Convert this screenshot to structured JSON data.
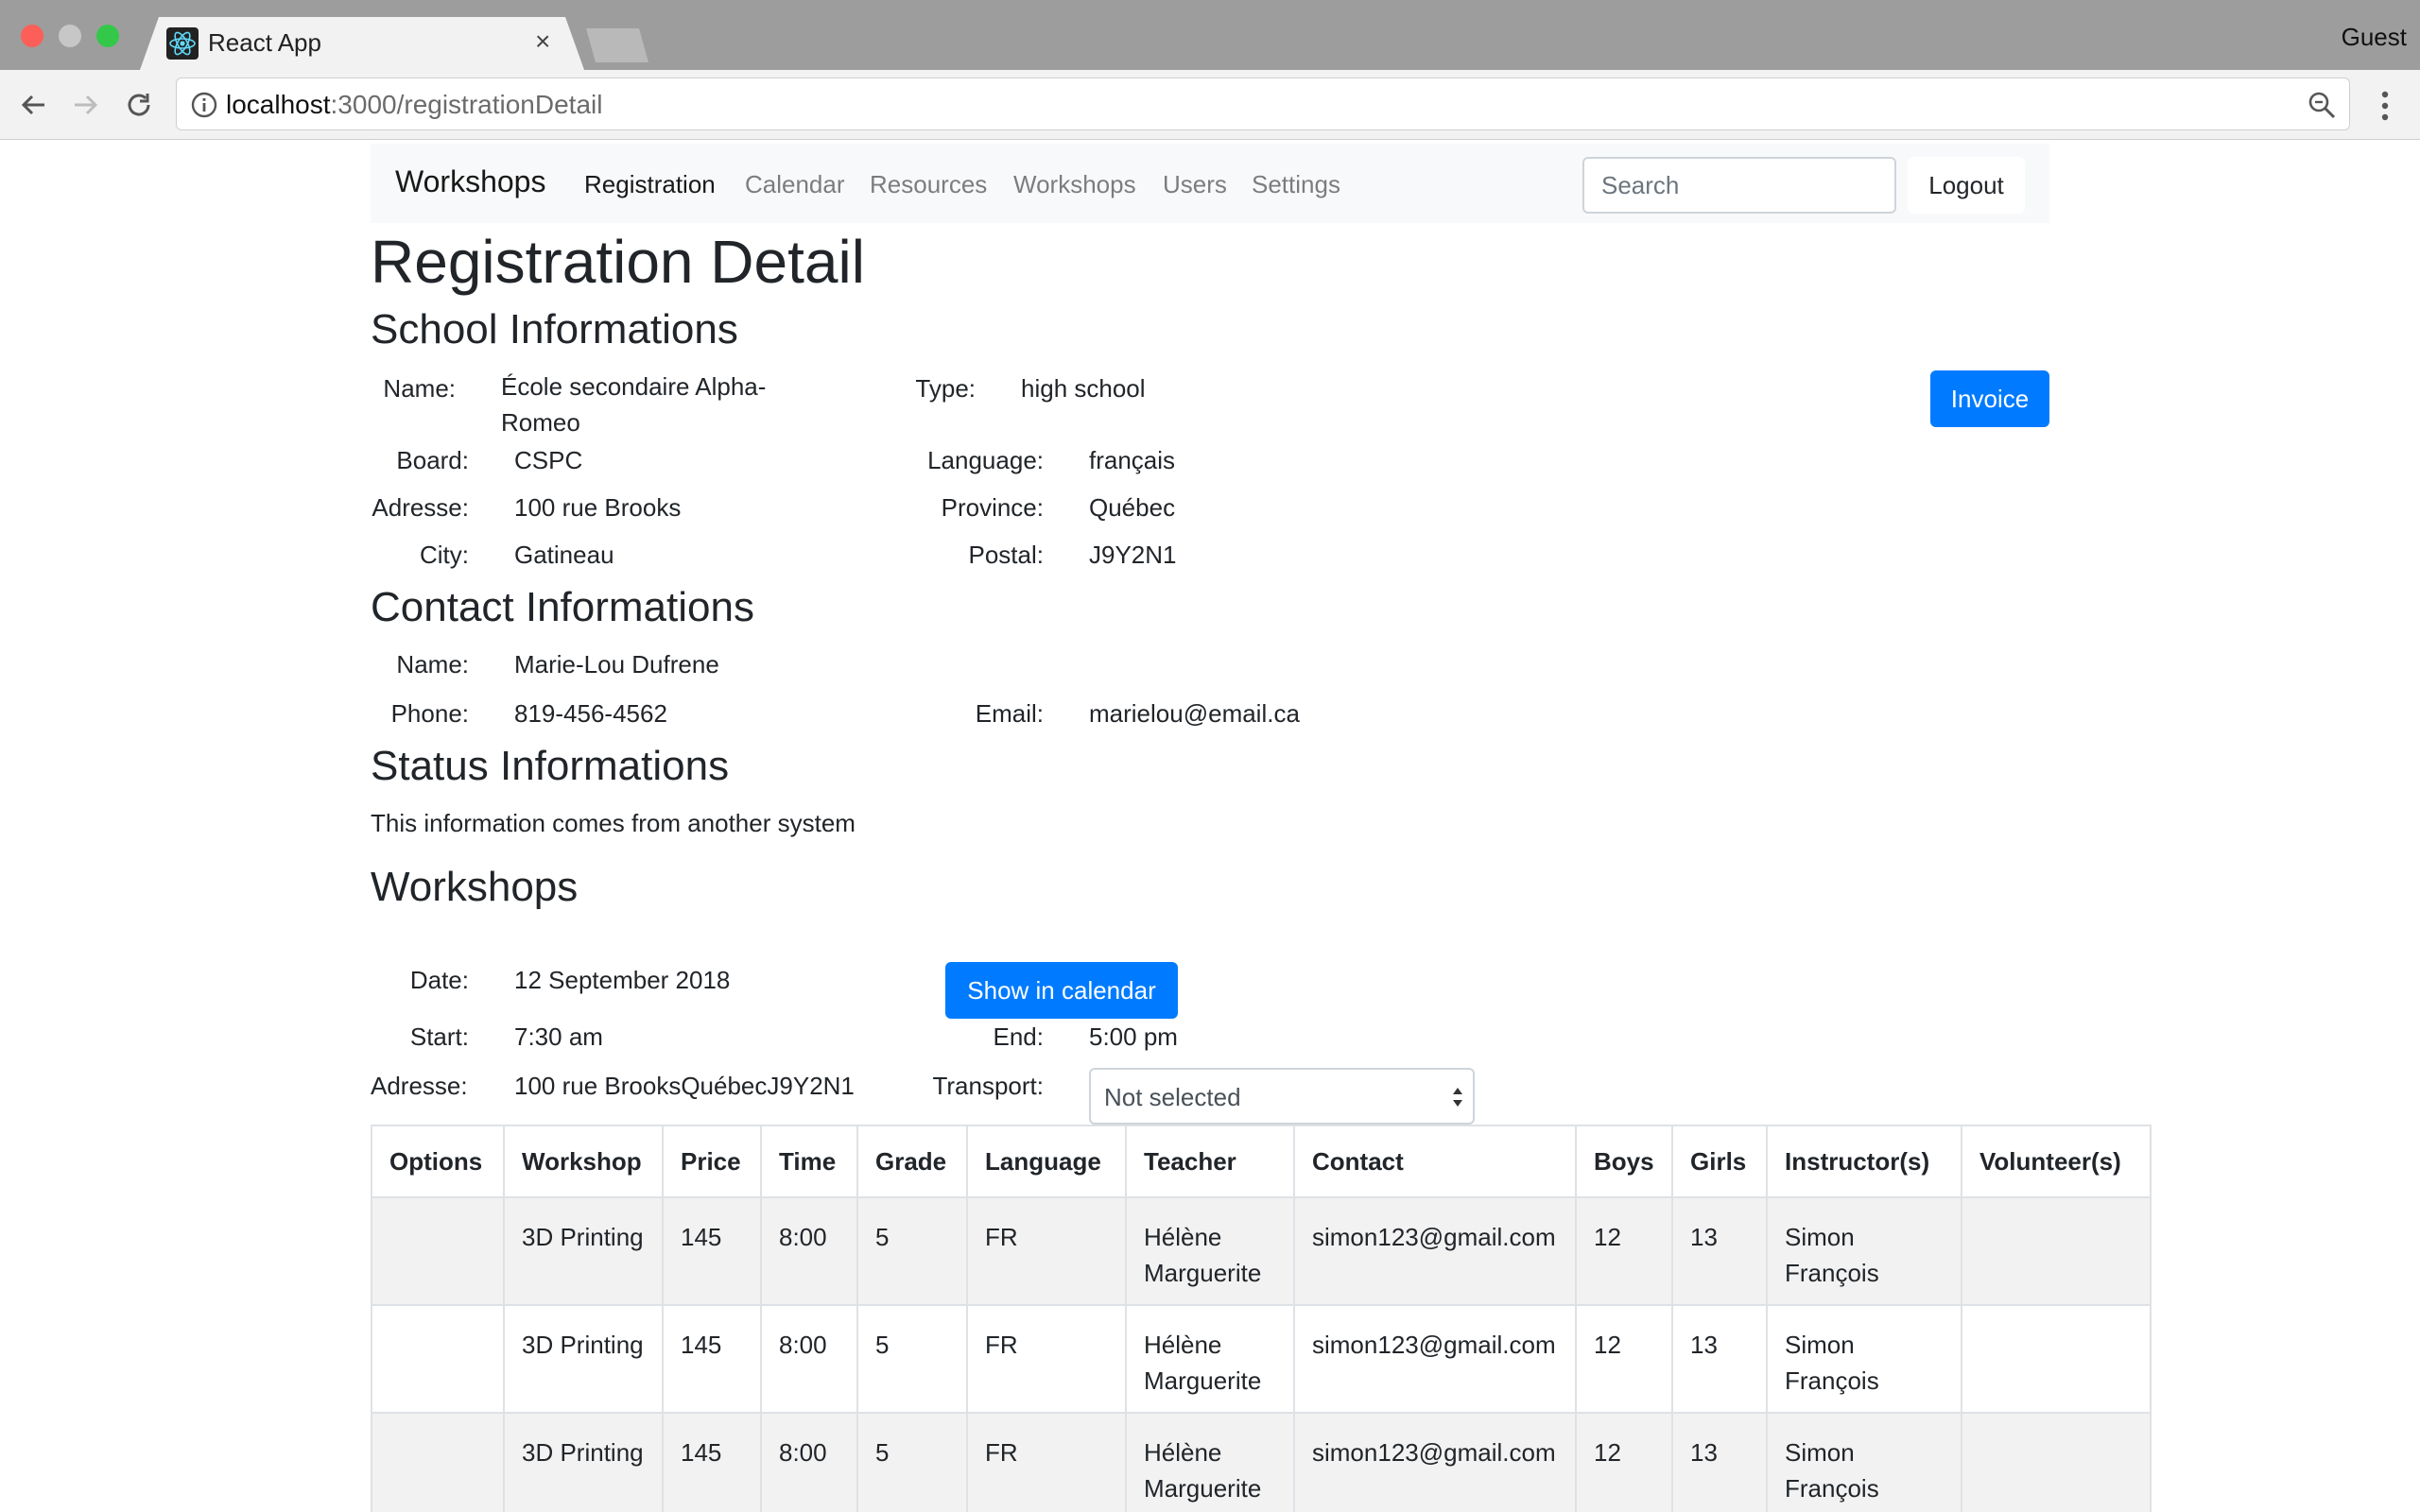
{
  "browser": {
    "tab_title": "React App",
    "guest_label": "Guest",
    "url_host": "localhost",
    "url_path": ":3000/registrationDetail"
  },
  "navbar": {
    "brand": "Workshops",
    "links": [
      "Registration",
      "Calendar",
      "Resources",
      "Workshops",
      "Users",
      "Settings"
    ],
    "active_link": "Registration",
    "search_placeholder": "Search",
    "logout_label": "Logout"
  },
  "page_title": "Registration Detail",
  "school": {
    "heading": "School Informations",
    "invoice_label": "Invoice",
    "name_label": "Name:",
    "name_value": "École secondaire Alpha-Romeo",
    "type_label": "Type:",
    "type_value": "high school",
    "board_label": "Board:",
    "board_value": "CSPC",
    "language_label": "Language:",
    "language_value": "français",
    "address_label": "Adresse:",
    "address_value": "100 rue Brooks",
    "province_label": "Province:",
    "province_value": "Québec",
    "city_label": "City:",
    "city_value": "Gatineau",
    "postal_label": "Postal:",
    "postal_value": "J9Y2N1"
  },
  "contact": {
    "heading": "Contact Informations",
    "name_label": "Name:",
    "name_value": "Marie-Lou Dufrene",
    "phone_label": "Phone:",
    "phone_value": "819-456-4562",
    "email_label": "Email:",
    "email_value": "marielou@email.ca"
  },
  "status": {
    "heading": "Status Informations",
    "text": "This information comes from another system"
  },
  "workshops": {
    "heading": "Workshops",
    "date_label": "Date:",
    "date_value": "12 September 2018",
    "calendar_button": "Show in calendar",
    "start_label": "Start:",
    "start_value": "7:30 am",
    "end_label": "End:",
    "end_value": "5:00 pm",
    "address_label": "Adresse:",
    "address_value": "100 rue BrooksQuébecJ9Y2N1",
    "transport_label": "Transport:",
    "transport_value": "Not selected",
    "table": {
      "columns": [
        "Options",
        "Workshop",
        "Price",
        "Time",
        "Grade",
        "Language",
        "Teacher",
        "Contact",
        "Boys",
        "Girls",
        "Instructor(s)",
        "Volunteer(s)"
      ],
      "rows": [
        [
          "",
          "3D Printing",
          "145",
          "8:00",
          "5",
          "FR",
          "Hélène Marguerite",
          "simon123@gmail.com",
          "12",
          "13",
          "Simon François",
          ""
        ],
        [
          "",
          "3D Printing",
          "145",
          "8:00",
          "5",
          "FR",
          "Hélène Marguerite",
          "simon123@gmail.com",
          "12",
          "13",
          "Simon François",
          ""
        ],
        [
          "",
          "3D Printing",
          "145",
          "8:00",
          "5",
          "FR",
          "Hélène Marguerite",
          "simon123@gmail.com",
          "12",
          "13",
          "Simon François",
          ""
        ]
      ]
    }
  },
  "colors": {
    "primary": "#007bff",
    "navbar_bg": "#f8f9fa",
    "table_stripe": "#f2f2f2"
  }
}
